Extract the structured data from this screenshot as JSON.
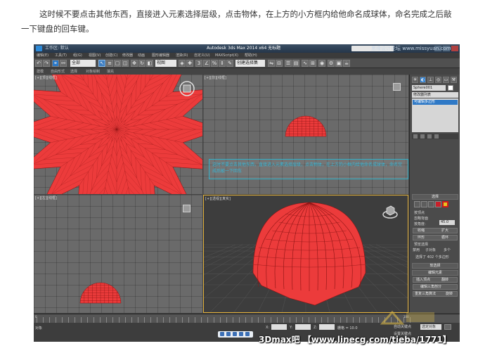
{
  "article": {
    "line1": "这时候不要点击其他东西，直接进入元素选择层级，点击物体，在上方的小方框内给他命名成球体，命名完成之后敲",
    "line2": "一下键盘的回车键。"
  },
  "app": {
    "title": "Autodesk 3ds Max 2014 x64  无标题",
    "quick_access": "工作区: 默认",
    "menus": [
      "编辑(E)",
      "工具(T)",
      "组(G)",
      "视图(V)",
      "创建(C)",
      "修改器",
      "动画",
      "图形编辑器",
      "渲染(R)",
      "自定义(U)",
      "MAXScript(X)",
      "帮助(H)"
    ],
    "selection_filter": "全部",
    "view_dropdown": "视图",
    "named_selection": "创建选择集",
    "ribbon_tabs": [
      "建模",
      "自由形式",
      "选择",
      "对象绘制",
      "填充"
    ]
  },
  "viewports": {
    "top_label": "[+][顶][线框]",
    "front_label": "[+][前][线框]",
    "left_label": "[+][左][线框]",
    "persp_label": "[+][透视][真实]",
    "colors": {
      "mesh": "#ec3b3b",
      "mesh_edge": "#8c1414",
      "active_border": "#e3b13a"
    }
  },
  "caption": {
    "text": "这时不要点击其他东西，直接进入元素选择层级，点击物体，在上方的小框内给他命名成球体，命名完成后敲一下回车"
  },
  "command_panel": {
    "name_field": "Sphere001",
    "modifier_list": "修改器列表",
    "stack_item": "可编辑多边形",
    "selection_rollout": "选择",
    "by_vertex": "按顶点",
    "ignore_backfacing": "忽略背面",
    "by_angle": "按角度:",
    "angle_value": "45.0",
    "shrink": "收缩",
    "grow": "扩大",
    "ring": "环形",
    "loop": "循环",
    "preview_selection": "预览选择",
    "off": "禁用",
    "subobj": "子对象",
    "multi": "多个",
    "selected_count": "选择了 402 个多边形",
    "soft_selection": "软选择",
    "edit_elements": "编辑元素",
    "insert_vertex": "插入顶点",
    "flip": "翻转",
    "edit_triangulation": "编辑三角剖分",
    "retriangulate": "重复三角算法",
    "rotate": "旋转"
  },
  "status": {
    "object_count": "对象",
    "timeline_start": "0",
    "timeline_end": "100",
    "x_field": "X:",
    "y_field": "Y:",
    "z_field": "Z:",
    "grid": "栅格 = 10.0",
    "auto_key": "自动关键点",
    "set_key": "设置关键点",
    "selected": "选定对象"
  },
  "overlay": {
    "watermark": "3Dmax吧 【www.linecg.com/tieba/1771】",
    "site_mark": "思缘设计论坛 www.missyuan.com"
  }
}
